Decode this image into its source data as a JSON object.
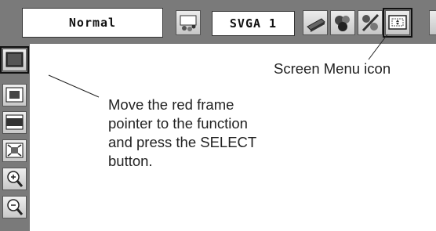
{
  "toolbar": {
    "mode_label": "Normal",
    "input_label": "SVGA 1",
    "icons": [
      "image-adjust-icon",
      "pc-adjust-icon",
      "image-select-icon",
      "setting-icon",
      "screen-menu-icon"
    ]
  },
  "sidebar": {
    "icons": [
      "normal-screen-icon",
      "true-screen-icon",
      "wide-screen-icon",
      "full-screen-icon",
      "digital-zoom-in-icon",
      "digital-zoom-out-icon"
    ]
  },
  "callouts": {
    "screen_menu_icon": "Screen Menu icon",
    "move_pointer_lines": [
      "Move the red frame",
      "pointer to the function",
      "and press the SELECT",
      "button."
    ]
  }
}
